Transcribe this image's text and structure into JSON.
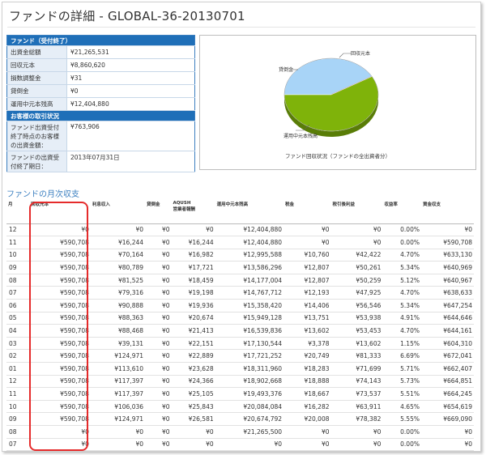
{
  "page": {
    "title": "ファンドの詳細 - GLOBAL-36-20130701"
  },
  "info": {
    "fund_header": "ファンド（受付終了）",
    "rows": [
      {
        "label": "出資金総額",
        "value": "¥21,265,531"
      },
      {
        "label": "回収元本",
        "value": "¥8,860,620"
      },
      {
        "label": "損数調整金",
        "value": "¥31"
      },
      {
        "label": "貸倒金",
        "value": "¥0"
      },
      {
        "label": "運用中元本残高",
        "value": "¥12,404,880"
      }
    ],
    "customer_header": "お客様の取引状況",
    "customer_rows": [
      {
        "label": "ファンド出資受付終了時点のお客様の出資金額：",
        "value": "¥763,906"
      },
      {
        "label": "ファンドの出資受付終了期日：",
        "value": "2013年07月31日"
      }
    ]
  },
  "chart_data": {
    "type": "pie",
    "title": "ファンド回収状況（ファンドの全出資者分）",
    "categories": [
      "回収元本",
      "貸倒金",
      "運用中元本残高"
    ],
    "values": [
      8860620,
      0,
      12404880
    ],
    "colors": {
      "回収元本": "#a8d4f7",
      "貸倒金": "#e05050",
      "運用中元本残高": "#7fb30a"
    }
  },
  "monthly": {
    "title": "ファンドの月次収支",
    "headers": {
      "month": "月",
      "principal": "回収元本",
      "interest": "利息収入",
      "default": "貸倒金",
      "aqush": "AQUSH",
      "aqush2": "営業者報酬",
      "balance": "運用中元本残高",
      "tax": "税金",
      "after_tax": "税引後利益",
      "yield": "収益率",
      "cash": "資金収支"
    },
    "rows": [
      [
        "12",
        "¥0",
        "¥0",
        "¥0",
        "¥0",
        "¥12,404,880",
        "¥0",
        "¥0",
        "0.00%",
        "¥0"
      ],
      [
        "11",
        "¥590,708",
        "¥16,244",
        "¥0",
        "¥16,244",
        "¥12,404,880",
        "¥0",
        "¥0",
        "0.00%",
        "¥590,708"
      ],
      [
        "10",
        "¥590,708",
        "¥70,164",
        "¥0",
        "¥16,982",
        "¥12,995,588",
        "¥10,760",
        "¥42,422",
        "4.70%",
        "¥633,130"
      ],
      [
        "09",
        "¥590,708",
        "¥80,789",
        "¥0",
        "¥17,721",
        "¥13,586,296",
        "¥12,807",
        "¥50,261",
        "5.34%",
        "¥640,969"
      ],
      [
        "08",
        "¥590,708",
        "¥81,525",
        "¥0",
        "¥18,459",
        "¥14,177,004",
        "¥12,807",
        "¥50,259",
        "5.12%",
        "¥640,967"
      ],
      [
        "07",
        "¥590,708",
        "¥79,316",
        "¥0",
        "¥19,198",
        "¥14,767,712",
        "¥12,193",
        "¥47,925",
        "4.70%",
        "¥638,633"
      ],
      [
        "06",
        "¥590,708",
        "¥90,888",
        "¥0",
        "¥19,936",
        "¥15,358,420",
        "¥14,406",
        "¥56,546",
        "5.34%",
        "¥647,254"
      ],
      [
        "05",
        "¥590,708",
        "¥88,363",
        "¥0",
        "¥20,674",
        "¥15,949,128",
        "¥13,751",
        "¥53,938",
        "4.91%",
        "¥644,646"
      ],
      [
        "04",
        "¥590,708",
        "¥88,468",
        "¥0",
        "¥21,413",
        "¥16,539,836",
        "¥13,602",
        "¥53,453",
        "4.70%",
        "¥644,161"
      ],
      [
        "03",
        "¥590,708",
        "¥39,131",
        "¥0",
        "¥22,151",
        "¥17,130,544",
        "¥3,378",
        "¥13,602",
        "1.15%",
        "¥604,310"
      ],
      [
        "02",
        "¥590,708",
        "¥124,971",
        "¥0",
        "¥22,889",
        "¥17,721,252",
        "¥20,749",
        "¥81,333",
        "6.69%",
        "¥672,041"
      ],
      [
        "01",
        "¥590,708",
        "¥113,610",
        "¥0",
        "¥23,628",
        "¥18,311,960",
        "¥18,283",
        "¥71,699",
        "5.71%",
        "¥662,407"
      ],
      [
        "12",
        "¥590,708",
        "¥117,397",
        "¥0",
        "¥24,366",
        "¥18,902,668",
        "¥18,888",
        "¥74,143",
        "5.73%",
        "¥664,851"
      ],
      [
        "11",
        "¥590,708",
        "¥117,397",
        "¥0",
        "¥25,105",
        "¥19,493,376",
        "¥18,667",
        "¥73,537",
        "5.51%",
        "¥664,245"
      ],
      [
        "10",
        "¥590,708",
        "¥106,036",
        "¥0",
        "¥25,843",
        "¥20,084,084",
        "¥16,282",
        "¥63,911",
        "4.65%",
        "¥654,619"
      ],
      [
        "09",
        "¥590,708",
        "¥124,971",
        "¥0",
        "¥26,581",
        "¥20,674,792",
        "¥20,008",
        "¥78,382",
        "5.55%",
        "¥669,090"
      ],
      [
        "08",
        "¥0",
        "¥0",
        "¥0",
        "¥0",
        "¥21,265,500",
        "¥0",
        "¥0",
        "0.00%",
        "¥0"
      ],
      [
        "07",
        "¥0",
        "¥0",
        "¥0",
        "¥0",
        "¥0",
        "¥0",
        "¥0",
        "0.00%",
        "¥0"
      ]
    ]
  }
}
